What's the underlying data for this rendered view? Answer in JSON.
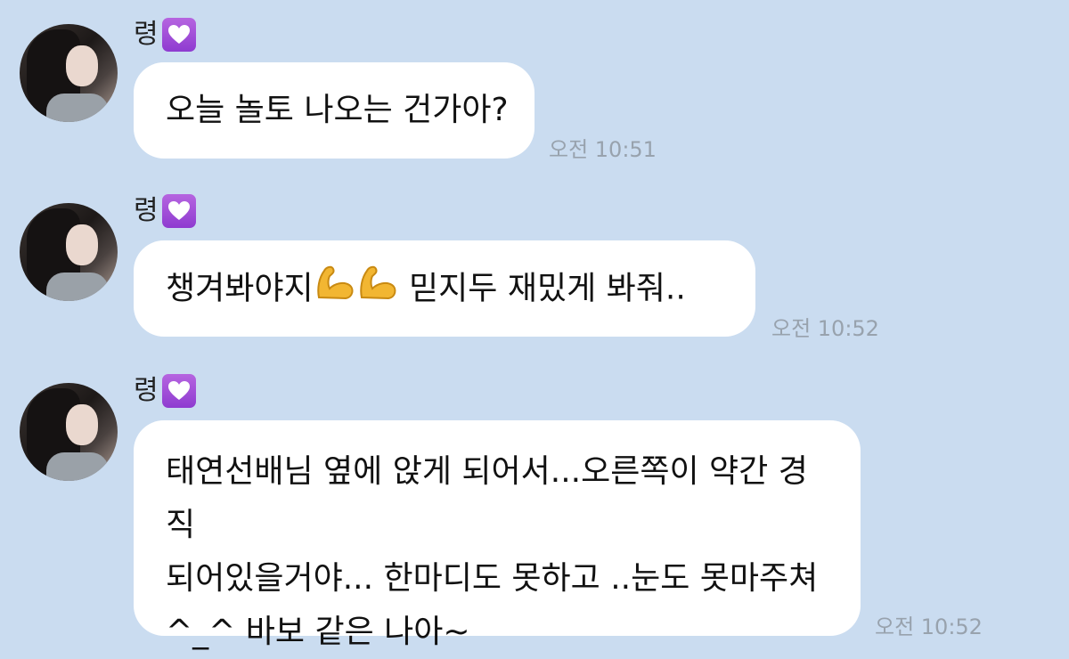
{
  "colors": {
    "background": "#cadcf0",
    "bubble": "#ffffff",
    "time": "#98a2ad",
    "badge": "#a04fd8"
  },
  "messages": [
    {
      "sender": "령",
      "badge_icon": "purple-heart-icon",
      "lines": [
        "오늘 놀토 나오는 건가아?"
      ],
      "time": "오전 10:51"
    },
    {
      "sender": "령",
      "badge_icon": "purple-heart-icon",
      "text_before": "챙겨봐야지",
      "emoji": "flexed-biceps-icon",
      "text_after": " 믿지두 재밌게 봐줘..",
      "time": "오전 10:52"
    },
    {
      "sender": "령",
      "badge_icon": "purple-heart-icon",
      "lines": [
        "태연선배님 옆에 앉게 되어서...오른쪽이 약간 경직",
        "되어있을거야... 한마디도 못하고 ..눈도 못마주쳐",
        "^_^ 바보 같은 나아~"
      ],
      "time": "오전 10:52"
    }
  ]
}
